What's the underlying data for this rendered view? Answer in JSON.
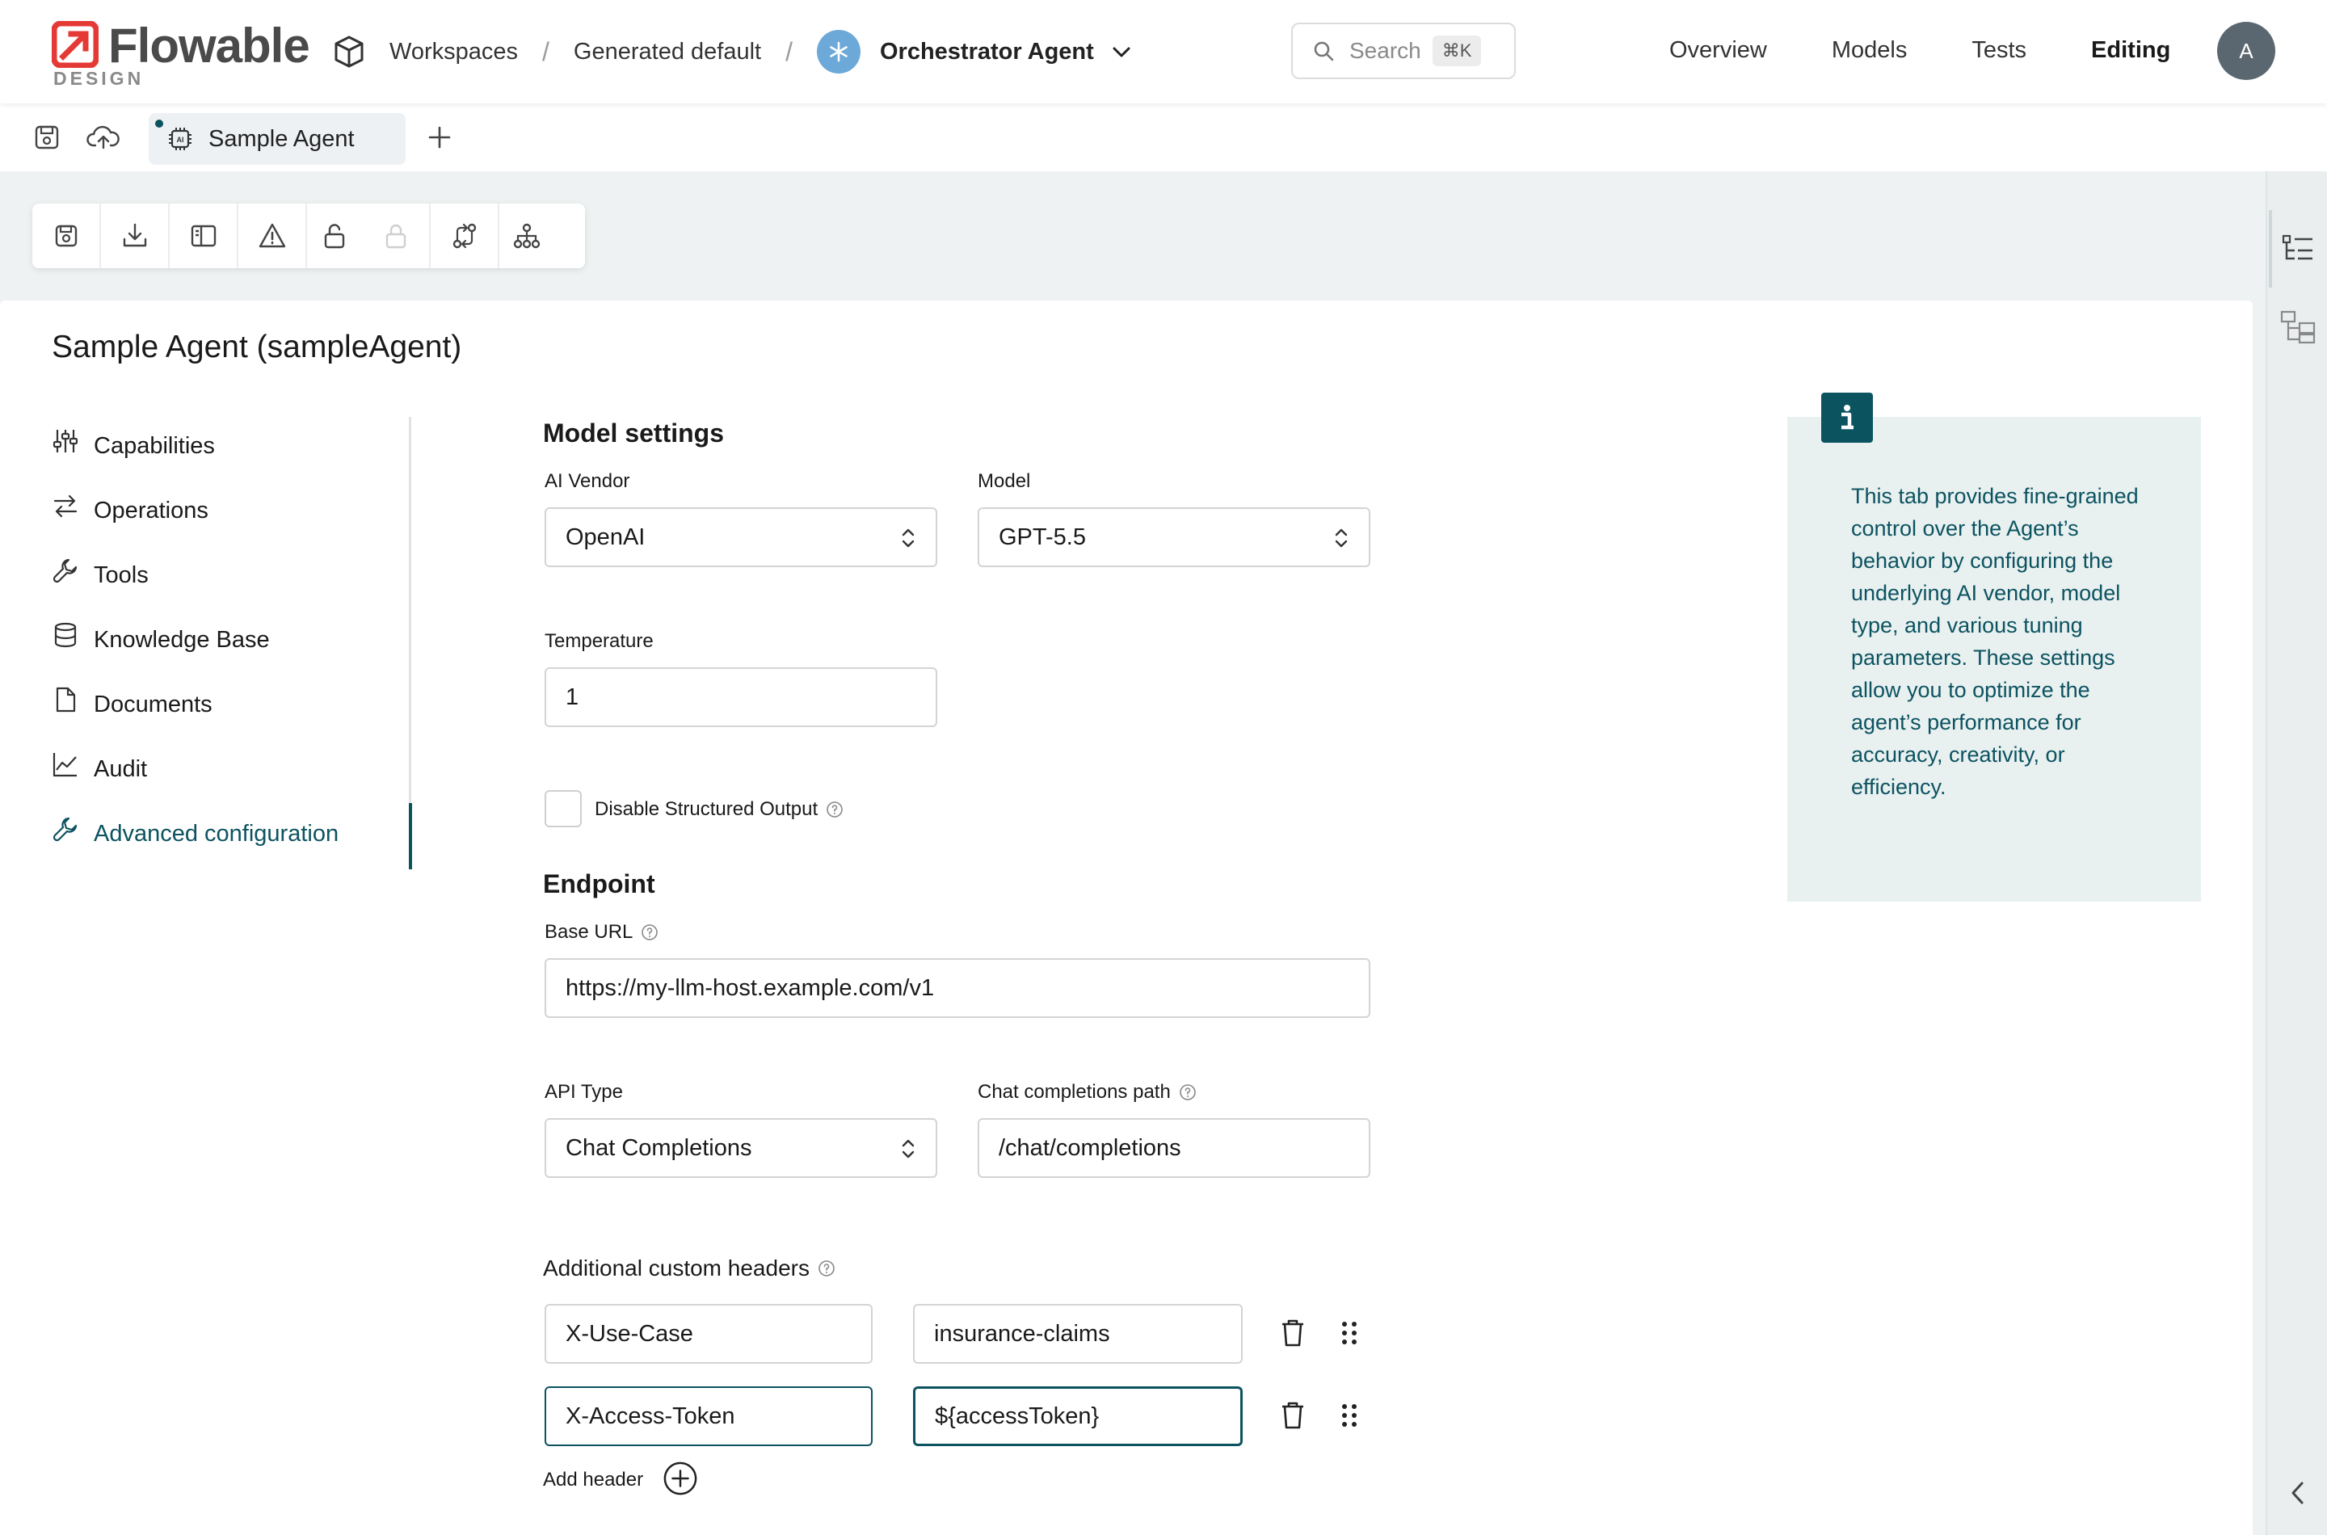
{
  "app": {
    "logo_word": "Flowable",
    "logo_sub": "DESIGN",
    "brand_color": "#e53935"
  },
  "breadcrumb": {
    "workspaces": "Workspaces",
    "sep": "/",
    "workspace": "Generated default",
    "model": "Orchestrator Agent"
  },
  "search": {
    "placeholder": "Search",
    "shortcut": "⌘K"
  },
  "topnav": [
    "Overview",
    "Models",
    "Tests",
    "Editing"
  ],
  "user": {
    "initial": "A"
  },
  "tabs": {
    "active_label": "Sample Agent"
  },
  "page": {
    "title": "Sample Agent (sampleAgent)"
  },
  "sidenav": [
    {
      "label": "Capabilities",
      "icon": "sliders-icon"
    },
    {
      "label": "Operations",
      "icon": "arrows-left-right-icon"
    },
    {
      "label": "Tools",
      "icon": "wrench-icon"
    },
    {
      "label": "Knowledge Base",
      "icon": "database-icon"
    },
    {
      "label": "Documents",
      "icon": "document-icon"
    },
    {
      "label": "Audit",
      "icon": "line-chart-icon"
    },
    {
      "label": "Advanced configuration",
      "icon": "wrench-icon",
      "active": true
    }
  ],
  "form": {
    "model_settings_title": "Model settings",
    "ai_vendor_label": "AI Vendor",
    "ai_vendor_value": "OpenAI",
    "model_label": "Model",
    "model_value": "GPT-5.5",
    "temperature_label": "Temperature",
    "temperature_value": "1",
    "disable_structured_output_label": "Disable Structured Output",
    "disable_structured_output_checked": false,
    "endpoint_title": "Endpoint",
    "base_url_label": "Base URL",
    "base_url_value": "https://my-llm-host.example.com/v1",
    "api_type_label": "API Type",
    "api_type_value": "Chat Completions",
    "chat_path_label": "Chat completions path",
    "chat_path_value": "/chat/completions",
    "headers_label": "Additional custom headers",
    "headers": [
      {
        "name": "X-Use-Case",
        "value": "insurance-claims"
      },
      {
        "name": "X-Access-Token",
        "value": "${accessToken}"
      }
    ],
    "add_header_label": "Add header"
  },
  "info": {
    "text": "This tab provides fine-grained control over the Agent’s behavior by configuring the underlying AI vendor, model type, and various tuning parameters. These settings allow you to optimize the agent’s performance for accuracy, creativity, or efficiency."
  },
  "colors": {
    "accent": "#0c5360",
    "info_bg": "#e8f0f0",
    "canvas_bg": "#eef2f2"
  }
}
